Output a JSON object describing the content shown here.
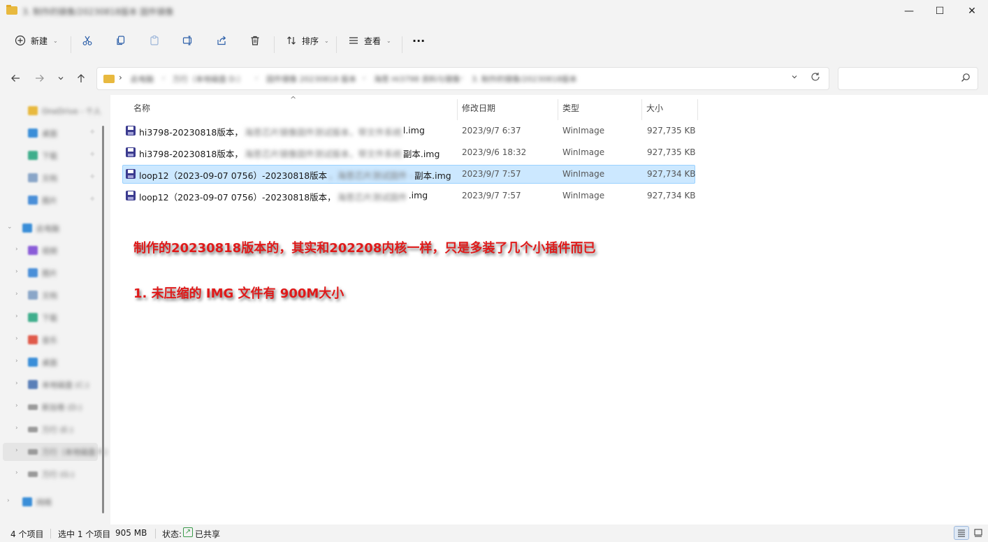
{
  "window": {
    "title": "3. 制作的镜像/20230818版本 固件镜像",
    "minimize": "—",
    "maximize": "☐",
    "close": "✕"
  },
  "toolbar": {
    "new_label": "新建",
    "sort_label": "排序",
    "view_label": "查看",
    "more": "···"
  },
  "address": {
    "sep": "›",
    "crumbs": [
      "此电脑",
      "万行（本地磁盘 D:）",
      "固件镜像 20230818 版本",
      "海思 Hi3798 资料与镜像",
      "3. 制作的镜像/20230818版本"
    ]
  },
  "sidebar": {
    "items": [
      {
        "label": "OneDrive - 个人"
      },
      {
        "label": "桌面"
      },
      {
        "label": "下载"
      },
      {
        "label": "文档"
      },
      {
        "label": "图片"
      },
      {
        "label": "此电脑"
      },
      {
        "label": "视频"
      },
      {
        "label": "图片"
      },
      {
        "label": "文档"
      },
      {
        "label": "下载"
      },
      {
        "label": "音乐"
      },
      {
        "label": "桌面"
      },
      {
        "label": "本地磁盘 (C:)"
      },
      {
        "label": "新加卷 (D:)"
      },
      {
        "label": "万行 (E:)"
      },
      {
        "label": "万行（本地磁盘 F:）"
      },
      {
        "label": "万行 (G:)"
      },
      {
        "label": "网络"
      }
    ]
  },
  "columns": {
    "name": "名称",
    "modified": "修改日期",
    "type": "类型",
    "size": "大小",
    "sort_indicator": "^"
  },
  "files": [
    {
      "prefix": "hi3798-20230818版本，",
      "mid": "海思芯片镜像固件测试版本，带文件系统",
      "suffix": "l.img",
      "date": "2023/9/7 6:37",
      "type": "WinImage",
      "size": "927,735 KB"
    },
    {
      "prefix": "hi3798-20230818版本，",
      "mid": "海思芯片镜像固件测试版本，带文件系统",
      "suffix": "副本.img",
      "date": "2023/9/6 18:32",
      "type": "WinImage",
      "size": "927,735 KB"
    },
    {
      "prefix": "loop12（2023-09-07 0756）-20230818版本",
      "mid": "，海思芯片测试固件 -",
      "suffix": "副本.img",
      "date": "2023/9/7 7:57",
      "type": "WinImage",
      "size": "927,734 KB"
    },
    {
      "prefix": "loop12（2023-09-07 0756）-20230818版本，",
      "mid": "海思芯片测试固件",
      "suffix": ".img",
      "date": "2023/9/7 7:57",
      "type": "WinImage",
      "size": "927,734 KB"
    }
  ],
  "annotations": {
    "line1": "制作的20230818版本的，其实和202208内核一样，只是多装了几个小插件而已",
    "line2": "1.  未压缩的 IMG 文件有 900M大小"
  },
  "status": {
    "count": "4 个项目",
    "selected": "选中 1 个项目",
    "selected_size": "905 MB",
    "state_label": "状态:",
    "shared": "已共享"
  }
}
